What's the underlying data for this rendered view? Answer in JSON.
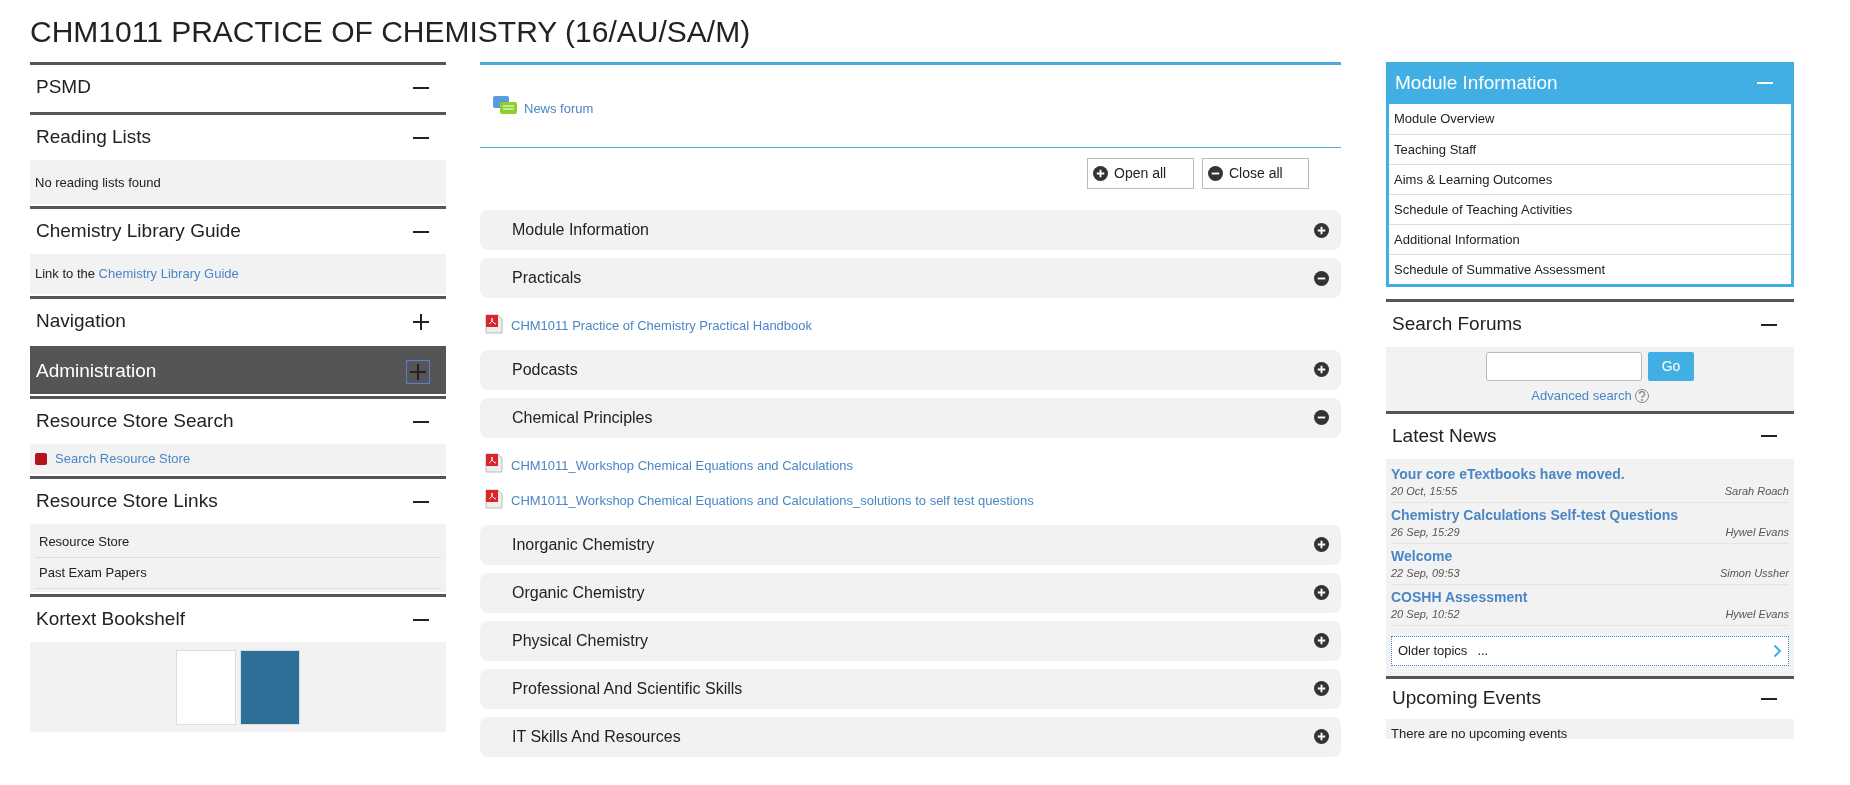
{
  "page_title": "CHM1011 PRACTICE OF CHEMISTRY (16/AU/SA/M)",
  "left_blocks": [
    {
      "title": "PSMD",
      "expanded": true,
      "highlighted": false
    },
    {
      "title": "Reading Lists",
      "expanded": true,
      "highlighted": false,
      "content": {
        "kind": "text",
        "text": "No reading lists found"
      }
    },
    {
      "title": "Chemistry Library Guide",
      "expanded": true,
      "highlighted": false,
      "content": {
        "kind": "sentence",
        "text": "Link to the ",
        "link": "Chemistry Library Guide"
      }
    },
    {
      "title": "Navigation",
      "expanded": false,
      "highlighted": false
    },
    {
      "title": "Administration",
      "expanded": false,
      "highlighted": true
    },
    {
      "title": "Resource Store Search",
      "expanded": true,
      "highlighted": false,
      "content": {
        "kind": "iconlink",
        "link": "Search Resource Store"
      }
    },
    {
      "title": "Resource Store Links",
      "expanded": true,
      "highlighted": false,
      "content": {
        "kind": "list",
        "items": [
          "Resource Store",
          "Past Exam Papers"
        ]
      }
    },
    {
      "title": "Kortext Bookshelf",
      "expanded": true,
      "highlighted": false,
      "content": {
        "kind": "books",
        "covers": [
          {
            "color": "#ffffff"
          },
          {
            "color": "#2d6f96"
          }
        ]
      }
    }
  ],
  "news_forum": "News forum",
  "buttons": [
    "Open all",
    "Close all"
  ],
  "sections": [
    {
      "title": "Module Information",
      "expanded": false
    },
    {
      "title": "Practicals",
      "expanded": true,
      "files": [
        "CHM1011 Practice of Chemistry Practical Handbook"
      ]
    },
    {
      "title": "Podcasts",
      "expanded": false
    },
    {
      "title": "Chemical Principles",
      "expanded": true,
      "files": [
        "CHM1011_Workshop Chemical Equations and Calculations",
        "CHM1011_Workshop Chemical Equations and Calculations_solutions to self test questions"
      ]
    },
    {
      "title": "Inorganic Chemistry",
      "expanded": false
    },
    {
      "title": "Organic Chemistry",
      "expanded": false
    },
    {
      "title": "Physical Chemistry",
      "expanded": false
    },
    {
      "title": "Professional And Scientific Skills",
      "expanded": false
    },
    {
      "title": "IT Skills And Resources",
      "expanded": false
    }
  ],
  "module_info": {
    "title": "Module Information",
    "expanded": true,
    "items": [
      "Module Overview",
      "Teaching Staff",
      "Aims & Learning Outcomes",
      "Schedule of Teaching Activities",
      "Additional Information",
      "Schedule of Summative Assessment"
    ]
  },
  "search_forums": {
    "title": "Search Forums",
    "expanded": true,
    "button": "Go",
    "advanced": "Advanced search"
  },
  "latest_news": {
    "title": "Latest News",
    "expanded": true,
    "items": [
      {
        "subject": "Your core eTextbooks have moved.",
        "date": "20 Oct, 15:55",
        "author": "Sarah Roach"
      },
      {
        "subject": "Chemistry Calculations Self-test Questions",
        "date": "26 Sep, 15:29",
        "author": "Hywel Evans"
      },
      {
        "subject": "Welcome",
        "date": "22 Sep, 09:53",
        "author": "Simon Ussher"
      },
      {
        "subject": "COSHH Assessment",
        "date": "20 Sep, 10:52",
        "author": "Hywel Evans"
      }
    ],
    "older": "Older topics",
    "older_dots": "..."
  },
  "upcoming_events": {
    "title": "Upcoming Events",
    "expanded": true,
    "text": "There are no upcoming events"
  }
}
